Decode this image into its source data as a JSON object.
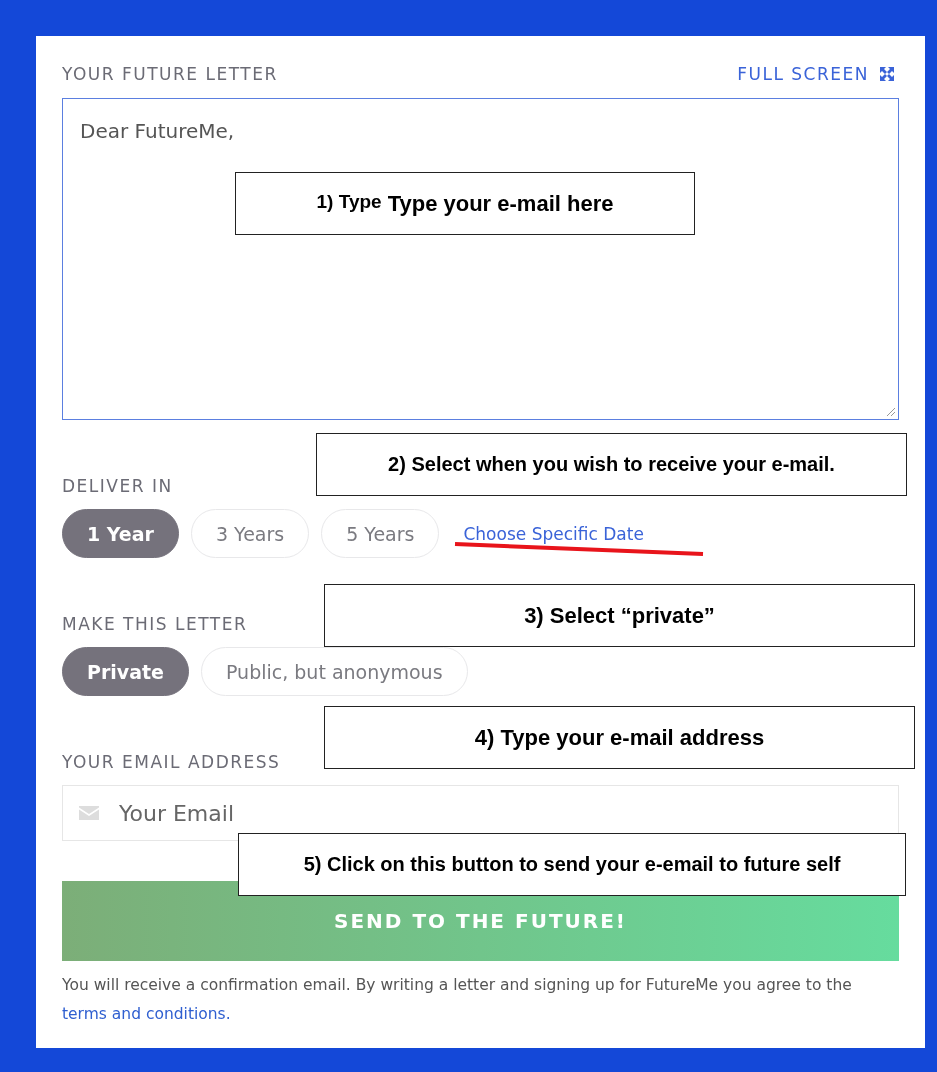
{
  "letter": {
    "heading": "YOUR FUTURE LETTER",
    "full_screen": "FULL SCREEN",
    "value": "Dear FutureMe,"
  },
  "deliver": {
    "label": "DELIVER IN",
    "options": [
      {
        "label": "1 Year",
        "selected": true
      },
      {
        "label": "3 Years",
        "selected": false
      },
      {
        "label": "5 Years",
        "selected": false
      }
    ],
    "link": "Choose Specific Date"
  },
  "privacy": {
    "label": "MAKE THIS LETTER",
    "options": [
      {
        "label": "Private",
        "selected": true
      },
      {
        "label": "Public, but anonymous",
        "selected": false
      }
    ]
  },
  "email": {
    "label": "YOUR EMAIL ADDRESS",
    "placeholder": "Your Email"
  },
  "submit": "SEND TO THE FUTURE!",
  "footer": {
    "text": "You will receive a confirmation email. By writing a letter and signing up for FutureMe you agree to the",
    "link": "terms and conditions."
  },
  "annotations": [
    {
      "lead": "1) Type",
      "text": "Type your e-mail here"
    },
    {
      "text": "2) Select when you wish to receive your e-mail."
    },
    {
      "text": "3) Select “private”"
    },
    {
      "text": "4) Type your e-mail address"
    },
    {
      "text": "5) Click on this button to send your e-email to future self"
    }
  ]
}
